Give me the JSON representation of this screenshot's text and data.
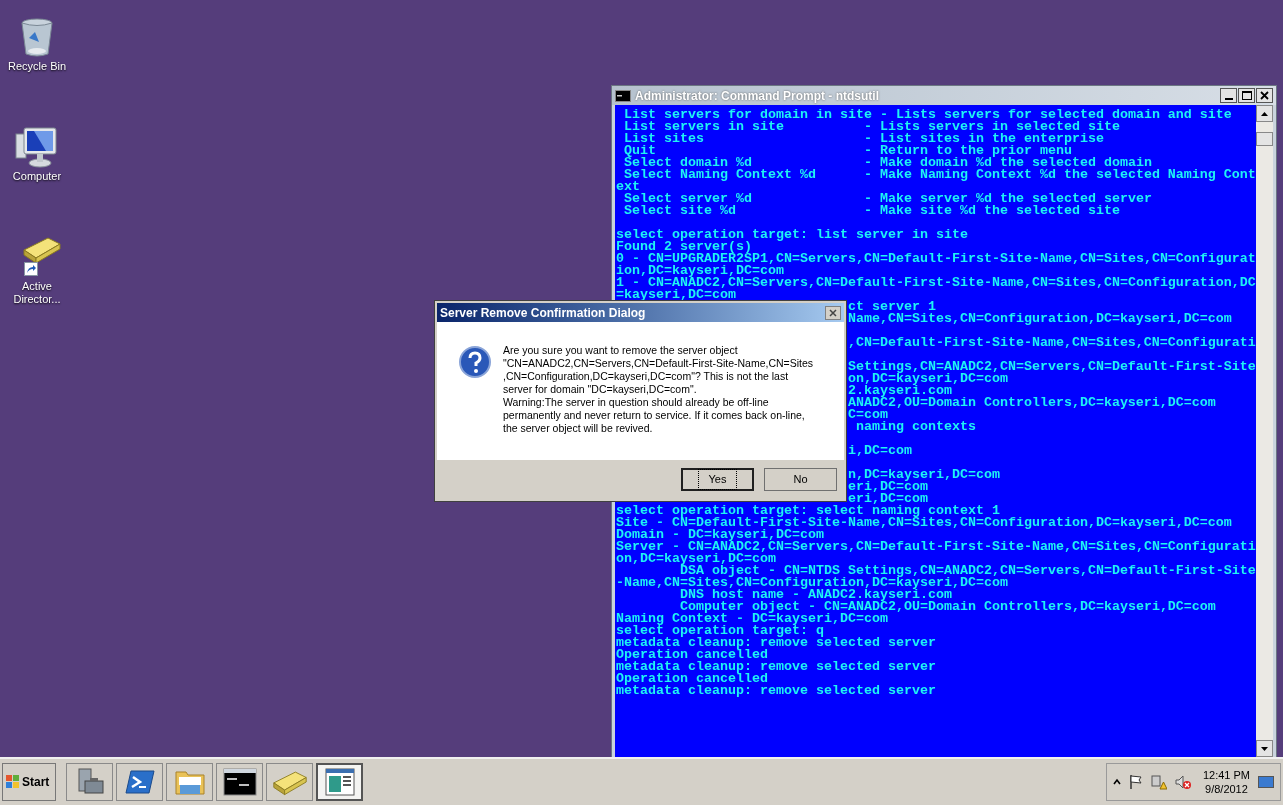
{
  "desktop_icons": [
    {
      "kind": "recycle-bin",
      "label": "Recycle Bin"
    },
    {
      "kind": "computer",
      "label": "Computer"
    },
    {
      "kind": "shortcut",
      "label": "Active Director..."
    }
  ],
  "console": {
    "title": "Administrator: Command Prompt - ntdsutil",
    "lines": [
      {
        "kind": "text",
        "text": " List servers for domain in site - Lists servers for selected domain and site"
      },
      {
        "kind": "text",
        "text": " List servers in site          - Lists servers in selected site"
      },
      {
        "kind": "text",
        "text": " List sites                    - List sites in the enterprise"
      },
      {
        "kind": "text",
        "text": " Quit                          - Return to the prior menu"
      },
      {
        "kind": "text",
        "text": " Select domain %d              - Make domain %d the selected domain"
      },
      {
        "kind": "text",
        "text": " Select Naming Context %d      - Make Naming Context %d the selected Naming Cont"
      },
      {
        "kind": "text",
        "text": "ext"
      },
      {
        "kind": "text",
        "text": " Select server %d              - Make server %d the selected server"
      },
      {
        "kind": "text",
        "text": " Select site %d                - Make site %d the selected site"
      },
      {
        "kind": "blank"
      },
      {
        "kind": "text",
        "text": "select operation target: list server in site"
      },
      {
        "kind": "text",
        "text": "Found 2 server(s)"
      },
      {
        "kind": "text",
        "text": "0 - CN=UPGRADER2SP1,CN=Servers,CN=Default-First-Site-Name,CN=Sites,CN=Configurat"
      },
      {
        "kind": "text",
        "text": "ion,DC=kayseri,DC=com"
      },
      {
        "kind": "text",
        "text": "1 - CN=ANADC2,CN=Servers,CN=Default-First-Site-Name,CN=Sites,CN=Configuration,DC"
      },
      {
        "kind": "text",
        "text": "=kayseri,DC=com"
      },
      {
        "kind": "covered",
        "text": "ct server 1"
      },
      {
        "kind": "covered",
        "text": "Name,CN=Sites,CN=Configuration,DC=kayseri,DC=com"
      },
      {
        "kind": "blank"
      },
      {
        "kind": "covered",
        "text": ",CN=Default-First-Site-Name,CN=Sites,CN=Configurati"
      },
      {
        "kind": "blank"
      },
      {
        "kind": "covered",
        "text": "Settings,CN=ANADC2,CN=Servers,CN=Default-First-Site"
      },
      {
        "kind": "covered",
        "text": "on,DC=kayseri,DC=com"
      },
      {
        "kind": "covered",
        "text": "2.kayseri.com"
      },
      {
        "kind": "covered",
        "text": "ANADC2,OU=Domain Controllers,DC=kayseri,DC=com"
      },
      {
        "kind": "covered",
        "text": "C=com"
      },
      {
        "kind": "covered",
        "text": " naming contexts"
      },
      {
        "kind": "blank"
      },
      {
        "kind": "covered",
        "text": "i,DC=com"
      },
      {
        "kind": "blank"
      },
      {
        "kind": "covered",
        "text": "n,DC=kayseri,DC=com"
      },
      {
        "kind": "covered",
        "text": "eri,DC=com"
      },
      {
        "kind": "covered",
        "text": "eri,DC=com"
      },
      {
        "kind": "text",
        "text": "select operation target: select naming context 1"
      },
      {
        "kind": "text",
        "text": "Site - CN=Default-First-Site-Name,CN=Sites,CN=Configuration,DC=kayseri,DC=com"
      },
      {
        "kind": "text",
        "text": "Domain - DC=kayseri,DC=com"
      },
      {
        "kind": "text",
        "text": "Server - CN=ANADC2,CN=Servers,CN=Default-First-Site-Name,CN=Sites,CN=Configurati"
      },
      {
        "kind": "text",
        "text": "on,DC=kayseri,DC=com"
      },
      {
        "kind": "text",
        "text": "        DSA object - CN=NTDS Settings,CN=ANADC2,CN=Servers,CN=Default-First-Site"
      },
      {
        "kind": "text",
        "text": "-Name,CN=Sites,CN=Configuration,DC=kayseri,DC=com"
      },
      {
        "kind": "text",
        "text": "        DNS host name - ANADC2.kayseri.com"
      },
      {
        "kind": "text",
        "text": "        Computer object - CN=ANADC2,OU=Domain Controllers,DC=kayseri,DC=com"
      },
      {
        "kind": "text",
        "text": "Naming Context - DC=kayseri,DC=com"
      },
      {
        "kind": "text",
        "text": "select operation target: q"
      },
      {
        "kind": "text",
        "text": "metadata cleanup: remove selected server"
      },
      {
        "kind": "text",
        "text": "Operation cancelled"
      },
      {
        "kind": "text",
        "text": "metadata cleanup: remove selected server"
      },
      {
        "kind": "text",
        "text": "Operation cancelled"
      },
      {
        "kind": "text",
        "text": "metadata cleanup: remove selected server"
      }
    ]
  },
  "dialog": {
    "title": "Server Remove Confirmation Dialog",
    "message_lines": [
      "Are you sure you want to remove the server object",
      "\"CN=ANADC2,CN=Servers,CN=Default-First-Site-Name,CN=Sites",
      ",CN=Configuration,DC=kayseri,DC=com\"?  This is not the last",
      "server for domain \"DC=kayseri,DC=com\".",
      "Warning:The server in question should already be off-line",
      "permanently and never return to service. If it comes back on-line,",
      "the server object will be revived."
    ],
    "buttons": [
      {
        "label": "Yes",
        "focused": true
      },
      {
        "label": "No",
        "focused": false
      }
    ]
  },
  "taskbar": {
    "start": "Start",
    "apps": [
      {
        "kind": "server-manager",
        "active": false
      },
      {
        "kind": "powershell",
        "active": false
      },
      {
        "kind": "explorer",
        "active": false
      },
      {
        "kind": "cmd",
        "active": false
      },
      {
        "kind": "directory",
        "active": false
      },
      {
        "kind": "window",
        "active": true
      }
    ],
    "clock": {
      "time": "12:41 PM",
      "date": "9/8/2012"
    }
  }
}
